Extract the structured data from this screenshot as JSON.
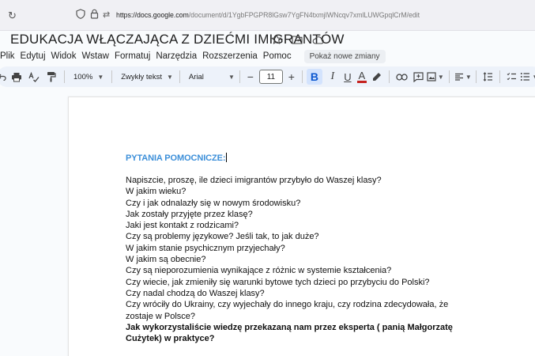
{
  "browser": {
    "url_host": "https://docs.google.com",
    "url_rest": "/document/d/1YgbFPGPR8lGsw7YgFN4txmjIWNcqv7xmlLUWGpqlCrM/edit"
  },
  "doc": {
    "title": "EDUKACJA WŁĄCZAJĄCA Z DZIEĆMI IMIGRANTÓW"
  },
  "menu": {
    "items": [
      "Plik",
      "Edytuj",
      "Widok",
      "Wstaw",
      "Formatuj",
      "Narzędzia",
      "Rozszerzenia",
      "Pomoc"
    ],
    "changes_chip": "Pokaż nowe zmiany"
  },
  "toolbar": {
    "zoom": "100%",
    "style": "Zwykły tekst",
    "font": "Arial",
    "size": "11",
    "minus": "−",
    "plus": "+",
    "bold": "B",
    "italic": "I",
    "underline": "U",
    "text_color": "A"
  },
  "content": {
    "heading": "PYTANIA POMOCNICZE:",
    "questions": [
      "Napiszcie, proszę, ile dzieci imigrantów przybyło do Waszej klasy?",
      "W jakim wieku?",
      "Czy i jak odnalazły się w nowym środowisku?",
      "Jak zostały przyjęte przez klasę?",
      "Jaki jest kontakt z rodzicami?",
      "Czy są problemy językowe? Jeśli tak, to jak duże?",
      "W jakim stanie psychicznym przyjechały?",
      "W jakim są obecnie?",
      "Czy są nieporozumienia wynikające z różnic w systemie kształcenia?",
      "Czy wiecie, jak zmieniły się warunki bytowe tych dzieci po przybyciu do Polski?",
      "Czy nadal chodzą do Waszej klasy?",
      "Czy wróciły do Ukrainy, czy wyjechały do innego kraju, czy rodzina zdecydowała, że zostaje w Polsce?"
    ],
    "final_question": "Jak wykorzystaliście wiedzę przekazaną nam przez eksperta ( panią Małgorzatę Cużytek) w praktyce?"
  },
  "colors": {
    "heading": "#3c8fd9",
    "toolbar_bg": "#edf2fa",
    "bold_active": "#0b57d0",
    "text_color_underline": "#c5221f"
  }
}
